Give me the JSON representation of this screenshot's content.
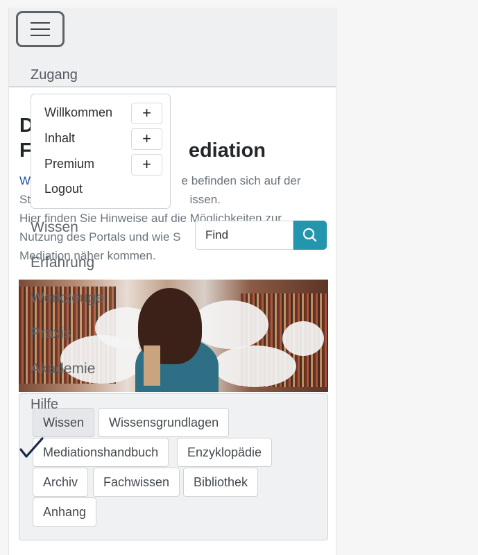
{
  "navbar": {
    "toggle_icon": "hamburger-menu-icon",
    "zugang_label": "Zugang"
  },
  "dropdown": {
    "items": [
      {
        "label": "Willkommen",
        "expand": "+"
      },
      {
        "label": "Inhalt",
        "expand": "+"
      },
      {
        "label": "Premium",
        "expand": "+"
      },
      {
        "label": "Logout"
      }
    ]
  },
  "main": {
    "heading_line1": "D",
    "heading_line2_prefix": "F",
    "heading_line2_suffix": "ediation",
    "para_link": "W",
    "para_line1_rest": "e befinden sich auf der",
    "para_line2_start": "St",
    "para_line2_end": "issen.",
    "para_line3": "Hier finden Sie Hinweise auf die Möglichkeiten zur",
    "para_line4_start": "Nutzung des Portals und wie S",
    "para_line5": "Mediation näher kommen."
  },
  "nav_links": [
    "Wissen",
    "Erfahrung",
    "Werkzeuge",
    "Praxis",
    "Akademie",
    "Hilfe"
  ],
  "search": {
    "placeholder": "Find",
    "button_icon": "search-icon"
  },
  "tags": [
    "Wissen",
    "Wissensgrundlagen",
    "Mediationshandbuch",
    "Enzyklopädie",
    "Archiv",
    "Fachwissen",
    "Bibliothek",
    "Anhang"
  ],
  "colors": {
    "accent": "#2396ad",
    "link": "#1f4fa8",
    "checkmark": "#1b2a4a"
  }
}
